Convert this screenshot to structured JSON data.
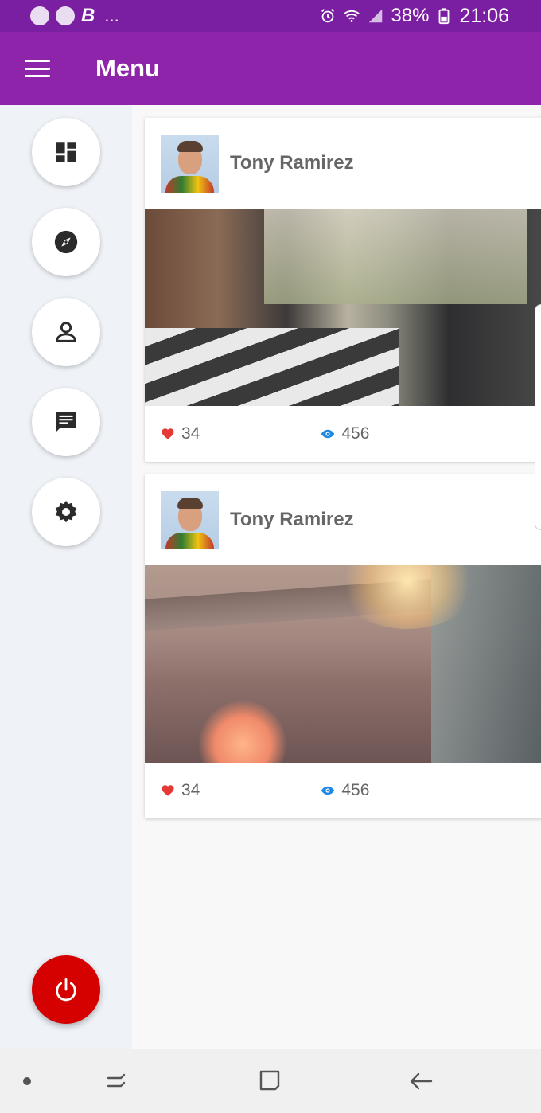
{
  "status_bar": {
    "b_letter": "B",
    "ellipsis": "...",
    "battery": "38%",
    "time": "21:06",
    "icons": [
      "messenger-icon",
      "chat-icon",
      "alarm-icon",
      "wifi-icon",
      "signal-icon",
      "battery-icon"
    ]
  },
  "app_bar": {
    "title": "Menu",
    "color": "#8e24aa",
    "status_color": "#7b1fa2"
  },
  "side_menu": {
    "items": [
      {
        "icon": "dashboard-icon"
      },
      {
        "icon": "compass-icon"
      },
      {
        "icon": "person-icon"
      },
      {
        "icon": "message-icon"
      },
      {
        "icon": "settings-icon"
      }
    ],
    "power": {
      "icon": "power-icon",
      "color": "#d50000"
    }
  },
  "posts": [
    {
      "author": "Tony Ramirez",
      "likes": "34",
      "views": "456",
      "image": "person driving car with sun flare"
    },
    {
      "author": "Tony Ramirez",
      "likes": "34",
      "views": "456",
      "image": "wooden boardwalk with glass railing"
    }
  ],
  "colors": {
    "heart": "#e53935",
    "eye": "#1e88e5"
  }
}
